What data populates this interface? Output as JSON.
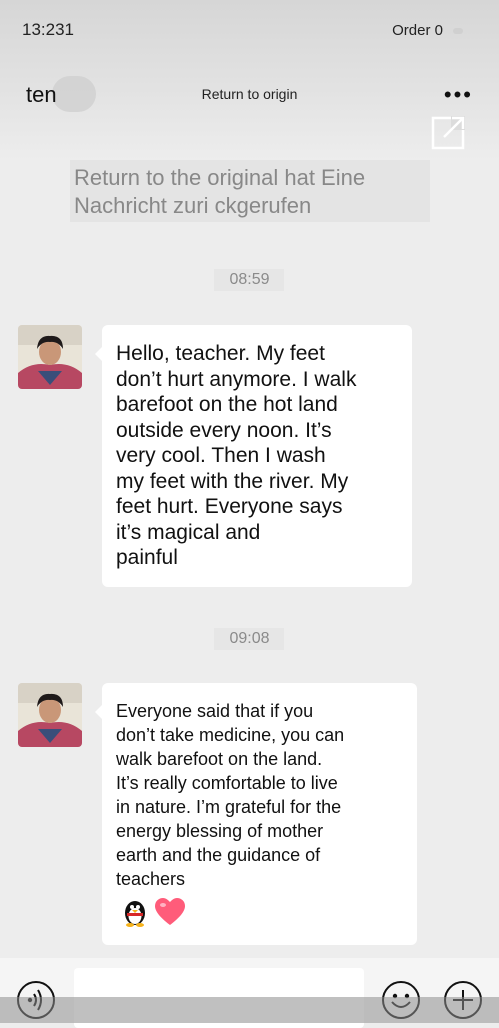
{
  "status_bar": {
    "time": "13:231",
    "right_label": "Order 0"
  },
  "header": {
    "back_title": "ten",
    "nav_title": "Return to origin",
    "more_icon": "more-dots-icon",
    "share_icon": "external-share-icon"
  },
  "notice": {
    "line1": "Return to the original hat Eine",
    "line2": "Nachricht zuri ckgerufen"
  },
  "messages": [
    {
      "timestamp": "08:59",
      "lines": [
        "Hello, teacher. My feet",
        "don’t hurt anymore. I walk",
        "barefoot on the hot land",
        "outside every noon. It’s",
        "very cool. Then I wash",
        "my feet with the river. My",
        "feet hurt. Everyone says",
        "it’s magical and",
        "painful"
      ]
    },
    {
      "timestamp": "09:08",
      "lines": [
        "Everyone said that if you",
        "don’t take medicine, you can",
        "walk barefoot on the land.",
        "It’s really comfortable to live",
        "in nature. I’m grateful for the",
        "energy blessing of mother",
        "earth and the guidance of",
        "teachers"
      ],
      "emojis": [
        "penguin-emoji",
        "heart-emoji"
      ]
    }
  ],
  "input_bar": {
    "voice_icon": "voice-icon",
    "emoji_icon": "smiley-icon",
    "plus_icon": "plus-icon"
  },
  "colors": {
    "background": "#ededed",
    "bubble": "#ffffff",
    "heart": "#ff5c7a"
  }
}
